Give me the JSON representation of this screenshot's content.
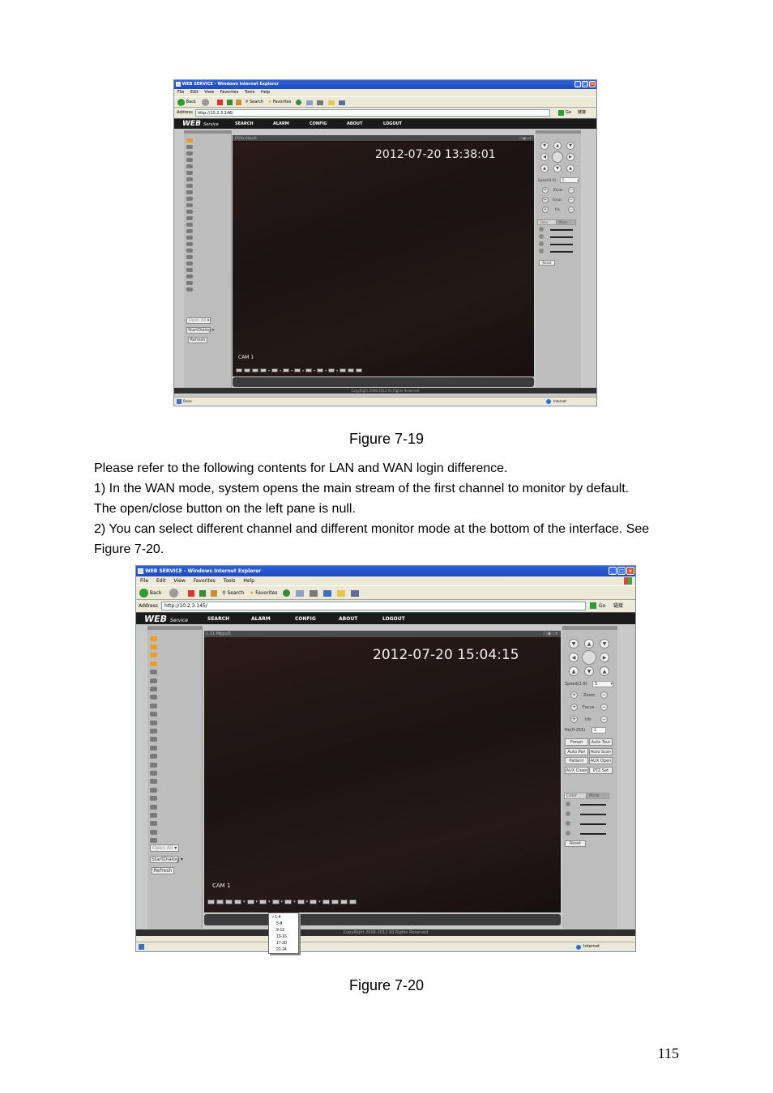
{
  "figure1": {
    "caption": "Figure 7-19",
    "window_title": "WEB SERVICE - Windows Internet Explorer",
    "menu": [
      "File",
      "Edit",
      "View",
      "Favorites",
      "Tools",
      "Help"
    ],
    "toolbar": {
      "back": "Back",
      "search": "Search",
      "favorites": "Favorites"
    },
    "address": {
      "label": "Address",
      "url": "http://10.2.3.146/",
      "go": "Go",
      "links": "链接"
    },
    "logo": {
      "main": "WEB",
      "sub": "Service"
    },
    "nav": [
      "SEARCH",
      "ALARM",
      "CONFIG",
      "ABOUT",
      "LOGOUT"
    ],
    "video_header": "1920x Kbps/6",
    "timestamp": "2012-07-20 13:38:01",
    "cam_label": "CAM 1",
    "left_buttons": {
      "open_all": "Open All",
      "start_dialog": "StartDialog",
      "refresh": "Refresh"
    },
    "ptz": {
      "speed_label": "Speed(1-8)",
      "speed_value": "5",
      "zoom": "Zoom",
      "focus": "Focus",
      "iris": "Iris"
    },
    "color_tabs": [
      "Color",
      "More"
    ],
    "reset": "Reset",
    "copyright": "CopyRight 2008-2012 All Rights Reserved",
    "status": {
      "done": "Done",
      "zone": "Internet"
    }
  },
  "body_text": [
    "Please refer to the following contents for LAN and WAN login difference.",
    "1) In the WAN mode, system opens the main stream of the first channel to monitor by default.",
    "The open/close button on the left pane is null.",
    "2) You can select different channel and different monitor mode at the bottom of the interface. See",
    "Figure 7-20."
  ],
  "figure2": {
    "caption": "Figure 7-20",
    "window_title": "WEB SERVICE - Windows Internet Explorer",
    "menu": [
      "File",
      "Edit",
      "View",
      "Favorites",
      "Tools",
      "Help"
    ],
    "toolbar": {
      "back": "Back",
      "search": "Search",
      "favorites": "Favorites"
    },
    "address": {
      "label": "Address",
      "url": "http://10.2.3.145/",
      "go": "Go",
      "links": "链接"
    },
    "logo": {
      "main": "WEB",
      "sub": "Service"
    },
    "nav": [
      "SEARCH",
      "ALARM",
      "CONFIG",
      "ABOUT",
      "LOGOUT"
    ],
    "video_header": "1.11 Mbps/6",
    "timestamp": "2012-07-20 15:04:15",
    "cam_label": "CAM 1",
    "left_buttons": {
      "open_all": "Open All",
      "start_dialog": "StartDialog",
      "refresh": "Refresh"
    },
    "ptz": {
      "speed_label": "Speed(1-8)",
      "speed_value": "5",
      "zoom": "Zoom",
      "focus": "Focus",
      "iris": "Iris",
      "no_label": "No(0-255)",
      "no_value": "1"
    },
    "ptz_buttons": [
      "Preset",
      "Auto Tour",
      "Auto Pan",
      "Auto Scan",
      "Pattern",
      "AUX Open",
      "AUX Close",
      "PTZ Set"
    ],
    "color_tabs": [
      "Color",
      "More"
    ],
    "reset": "Reset",
    "copyright": "CopyRight 2008-2012 All Rights Reserved",
    "status": {
      "zone": "Internet"
    },
    "channel_menu": [
      "1-4",
      "5-8",
      "9-12",
      "13-16",
      "17-20",
      "21-24"
    ],
    "channel_menu_selected": "1-4"
  },
  "page_number": "115"
}
